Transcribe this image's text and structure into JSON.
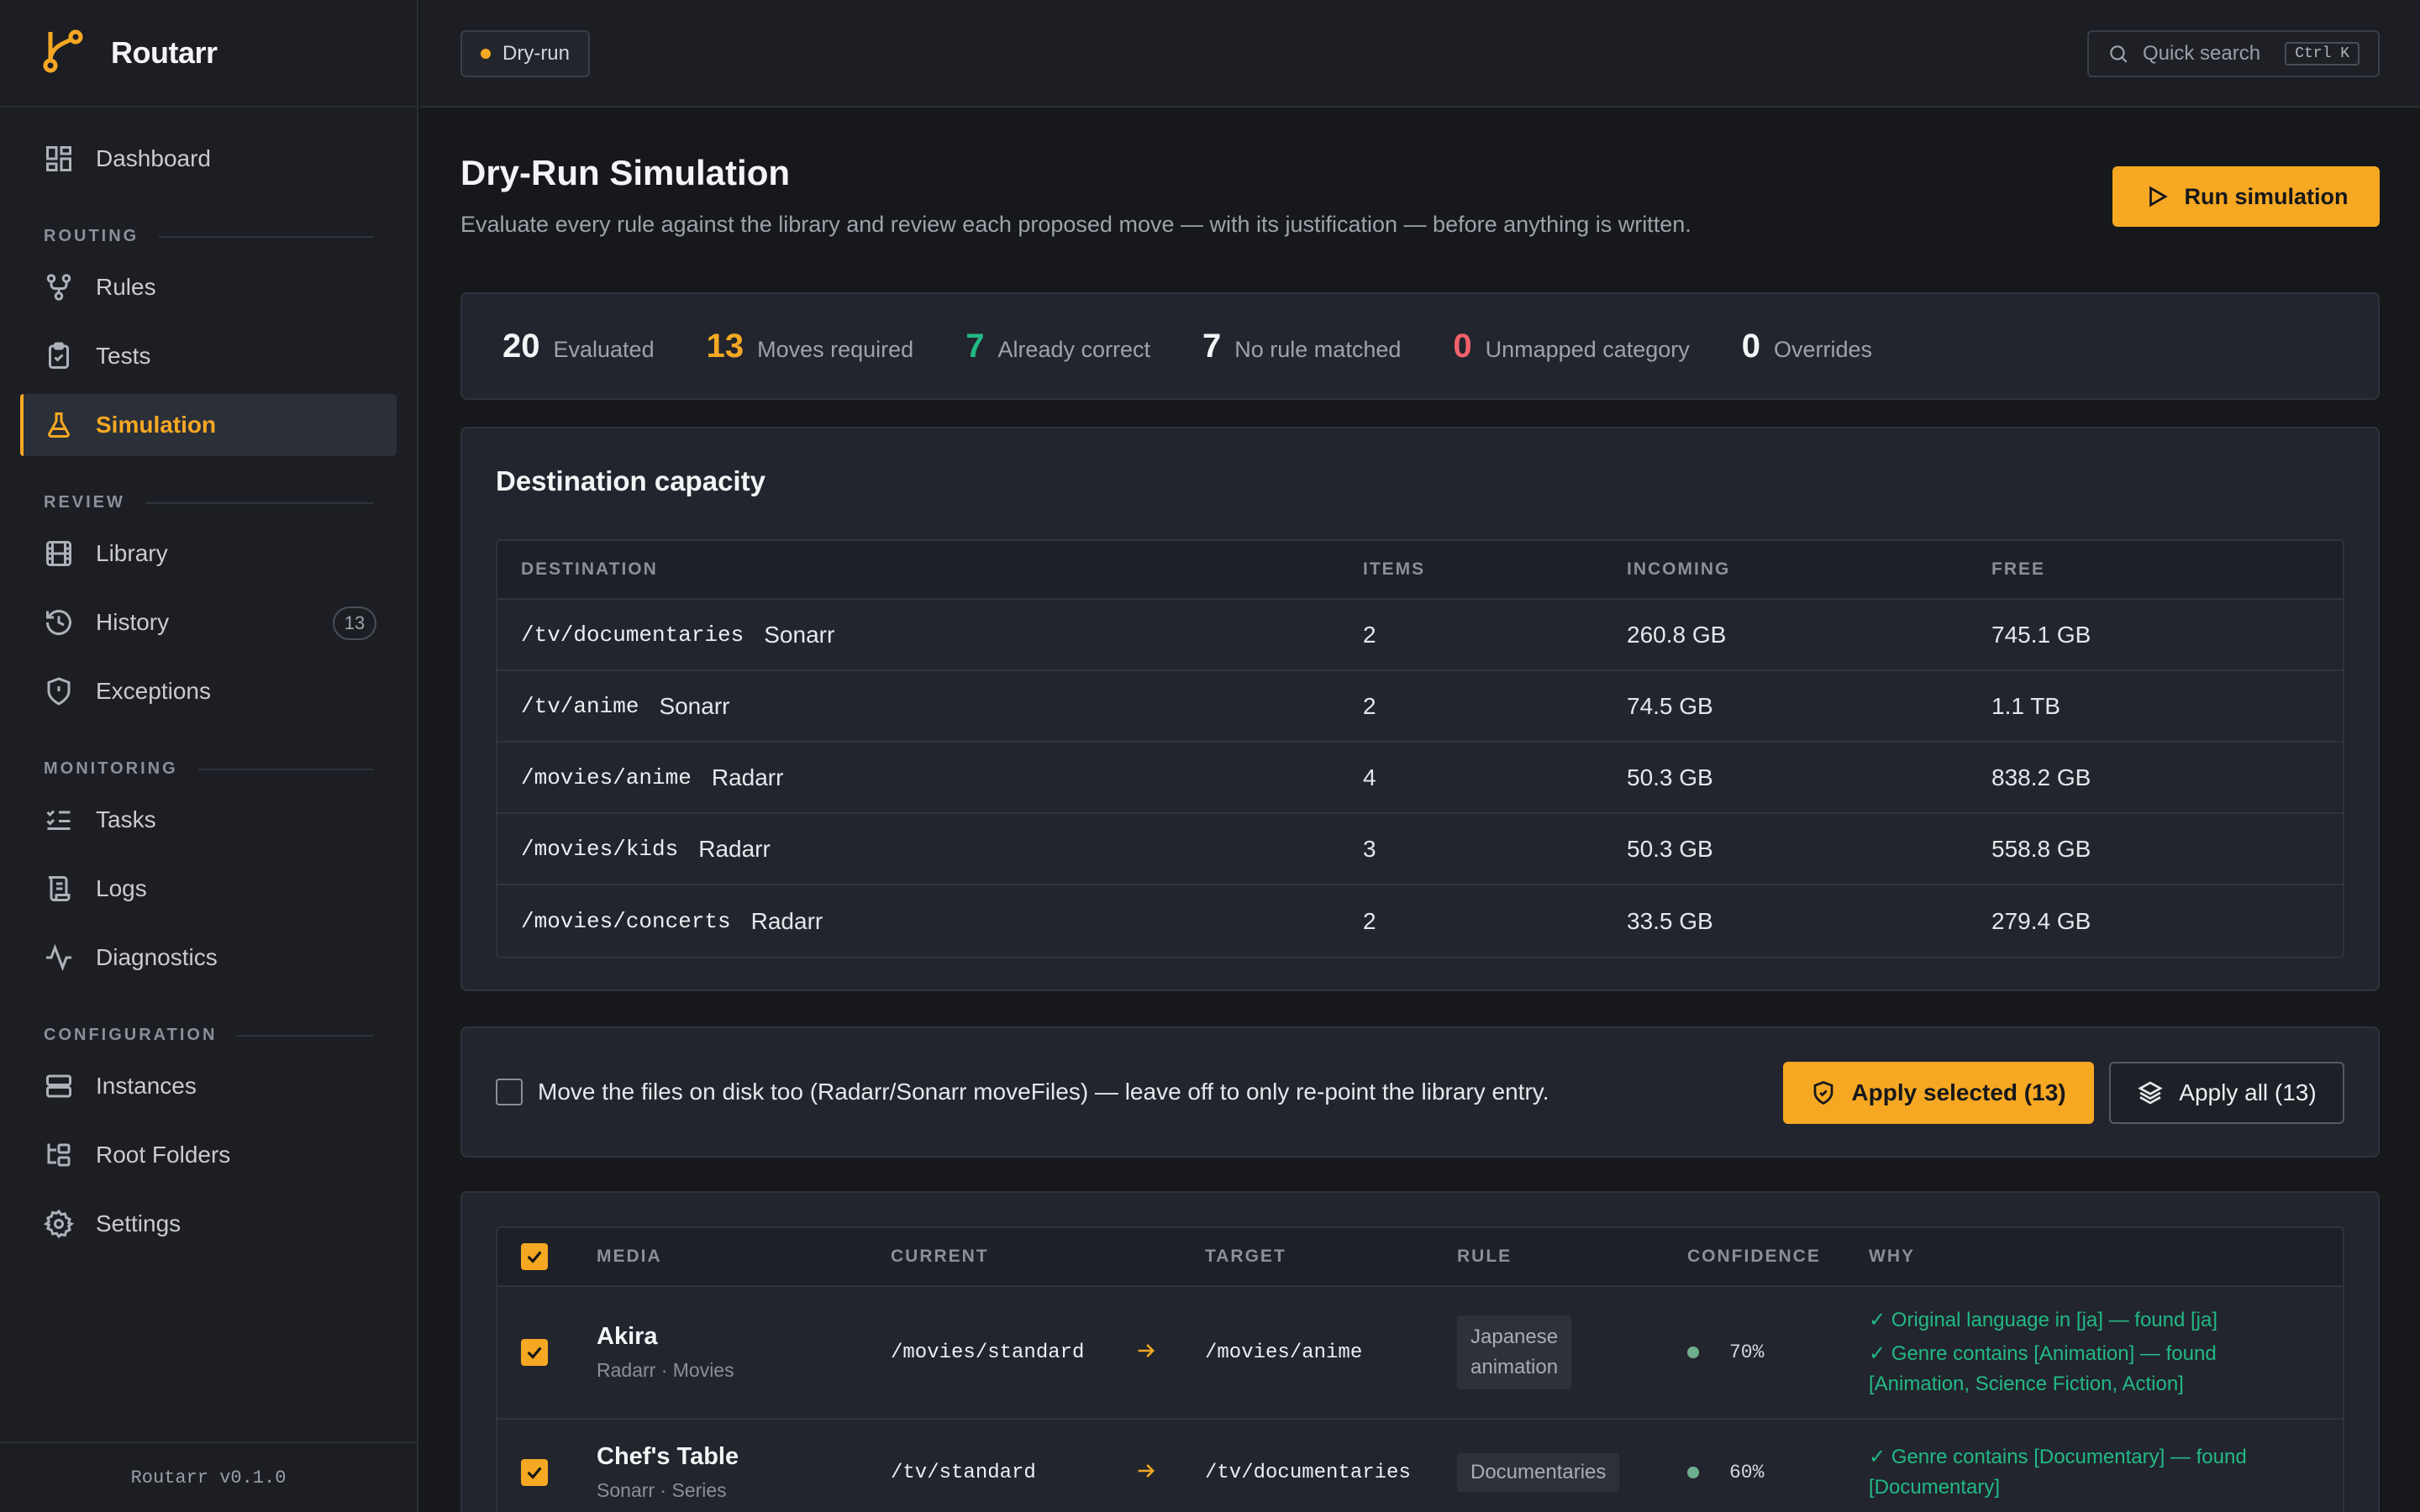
{
  "brand": {
    "name": "Routarr"
  },
  "sidebar": {
    "items_top": [
      {
        "label": "Dashboard"
      }
    ],
    "sections": [
      {
        "label": "ROUTING",
        "items": [
          {
            "label": "Rules"
          },
          {
            "label": "Tests"
          },
          {
            "label": "Simulation",
            "active": true
          }
        ]
      },
      {
        "label": "REVIEW",
        "items": [
          {
            "label": "Library"
          },
          {
            "label": "History",
            "badge": "13"
          },
          {
            "label": "Exceptions"
          }
        ]
      },
      {
        "label": "MONITORING",
        "items": [
          {
            "label": "Tasks"
          },
          {
            "label": "Logs"
          },
          {
            "label": "Diagnostics"
          }
        ]
      },
      {
        "label": "CONFIGURATION",
        "items": [
          {
            "label": "Instances"
          },
          {
            "label": "Root Folders"
          },
          {
            "label": "Settings"
          }
        ]
      }
    ],
    "version": "Routarr v0.1.0"
  },
  "topbar": {
    "mode": "Dry-run",
    "search_placeholder": "Quick search",
    "shortcut": "Ctrl K"
  },
  "page": {
    "title": "Dry-Run Simulation",
    "subtitle": "Evaluate every rule against the library and review each proposed move — with its justification — before anything is written.",
    "run_button": "Run simulation"
  },
  "stats": [
    {
      "value": "20",
      "label": "Evaluated"
    },
    {
      "value": "13",
      "label": "Moves required"
    },
    {
      "value": "7",
      "label": "Already correct"
    },
    {
      "value": "7",
      "label": "No rule matched"
    },
    {
      "value": "0",
      "label": "Unmapped category"
    },
    {
      "value": "0",
      "label": "Overrides"
    }
  ],
  "capacity": {
    "title": "Destination capacity",
    "headers": {
      "destination": "DESTINATION",
      "items": "ITEMS",
      "incoming": "INCOMING",
      "free": "FREE"
    },
    "rows": [
      {
        "path": "/tv/documentaries",
        "app": "Sonarr",
        "items": "2",
        "incoming": "260.8 GB",
        "free": "745.1 GB"
      },
      {
        "path": "/tv/anime",
        "app": "Sonarr",
        "items": "2",
        "incoming": "74.5 GB",
        "free": "1.1 TB"
      },
      {
        "path": "/movies/anime",
        "app": "Radarr",
        "items": "4",
        "incoming": "50.3 GB",
        "free": "838.2 GB"
      },
      {
        "path": "/movies/kids",
        "app": "Radarr",
        "items": "3",
        "incoming": "50.3 GB",
        "free": "558.8 GB"
      },
      {
        "path": "/movies/concerts",
        "app": "Radarr",
        "items": "2",
        "incoming": "33.5 GB",
        "free": "279.4 GB"
      }
    ]
  },
  "apply": {
    "move_files_label": "Move the files on disk too (Radarr/Sonarr moveFiles) — leave off to only re-point the library entry.",
    "move_files_checked": false,
    "apply_selected": "Apply selected (13)",
    "apply_all": "Apply all (13)"
  },
  "moves": {
    "headers": {
      "media": "MEDIA",
      "current": "CURRENT",
      "target": "TARGET",
      "rule": "RULE",
      "confidence": "CONFIDENCE",
      "why": "WHY"
    },
    "rows": [
      {
        "title": "Akira",
        "meta": "Radarr · Movies",
        "current": "/movies/standard",
        "target": "/movies/anime",
        "rule_line1": "Japanese",
        "rule_line2": "animation",
        "confidence": "70%",
        "why": [
          "✓ Original language in [ja] — found [ja]",
          "✓ Genre contains [Animation] — found",
          "[Animation, Science Fiction, Action]"
        ]
      },
      {
        "title": "Chef's Table",
        "meta": "Sonarr · Series",
        "current": "/tv/standard",
        "target": "/tv/documentaries",
        "rule": "Documentaries",
        "confidence": "60%",
        "why": [
          "✓ Genre contains [Documentary] — found",
          "[Documentary]"
        ]
      }
    ]
  },
  "colors": {
    "accent": "#f6a823",
    "success": "#22b985",
    "danger": "#f2626b",
    "background": "#17181c",
    "surface": "#22252d"
  }
}
